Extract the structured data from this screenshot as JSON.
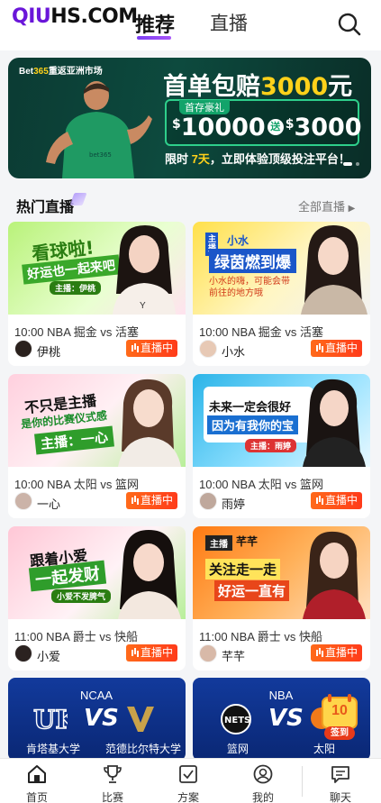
{
  "header": {
    "logo": "QIUHS.COM",
    "tabs": [
      {
        "label": "推荐",
        "active": true
      },
      {
        "label": "直播",
        "active": false
      }
    ]
  },
  "banner": {
    "tag_prefix": "Bet",
    "tag_num": "365",
    "tag_suffix": "重返亚洲市场",
    "headline": "首单包赔",
    "headline_amount": "3000",
    "headline_unit": "元",
    "box_label": "首存豪礼",
    "deposit": "10000",
    "send": "送",
    "bonus": "3000",
    "currency": "$",
    "footer_pre": "限时",
    "footer_days": "7天",
    "footer_post": "，立即体验顶级投注平台！"
  },
  "section": {
    "title": "热门直播",
    "more": "全部直播"
  },
  "live_badge": "直播中",
  "streams": [
    {
      "match": "10:00 NBA 掘金 vs 活塞",
      "anchor": "伊桃",
      "thumb_line1": "看球啦!",
      "thumb_line2": "好运也一起来吧",
      "thumb_tag": "主播：伊桃",
      "theme": "#7fd93a"
    },
    {
      "match": "10:00 NBA 掘金 vs 活塞",
      "anchor": "小水",
      "thumb_line1": "小水",
      "thumb_line2": "绿茵燃到爆",
      "thumb_tag": "小水的嗨，可能会带前往的地方哦",
      "theme": "#ffc928"
    },
    {
      "match": "10:00 NBA 太阳 vs 篮网",
      "anchor": "一心",
      "thumb_line1": "不只是主播",
      "thumb_line2": "是你的比赛仪式感",
      "thumb_tag": "主播：一心",
      "theme": "#8fe08a"
    },
    {
      "match": "10:00 NBA 太阳 vs 篮网",
      "anchor": "雨婷",
      "thumb_line1": "未来一定会很好",
      "thumb_line2": "因为有我你的宝",
      "thumb_tag": "主播：雨婷",
      "theme": "#2bb4e8"
    },
    {
      "match": "11:00 NBA 爵士 vs 快船",
      "anchor": "小爱",
      "thumb_line1": "跟着小爱",
      "thumb_line2": "一起发财",
      "thumb_tag": "小爱不发脾气",
      "theme": "#f6b8c8"
    },
    {
      "match": "11:00 NBA 爵士 vs 快船",
      "anchor": "芊芊",
      "thumb_line1": "关注走一走",
      "thumb_line2": "好运一直有",
      "thumb_tag": "主播 芊芊",
      "theme": "#ff8a1f"
    }
  ],
  "sports": [
    {
      "league": "NCAA",
      "vs": "VS",
      "home": "肯塔基大学",
      "away": "范德比尔特大学"
    },
    {
      "league": "NBA",
      "vs": "VS",
      "home": "篮网",
      "away": "太阳",
      "badge_num": "10",
      "badge_label": "签到"
    }
  ],
  "bottom_nav": [
    {
      "label": "首页",
      "icon": "home-icon",
      "active": true
    },
    {
      "label": "比赛",
      "icon": "trophy-icon",
      "active": false
    },
    {
      "label": "方案",
      "icon": "checklist-icon",
      "active": false
    },
    {
      "label": "我的",
      "icon": "user-icon",
      "active": false
    },
    {
      "label": "聊天",
      "icon": "chat-icon",
      "active": false
    }
  ]
}
